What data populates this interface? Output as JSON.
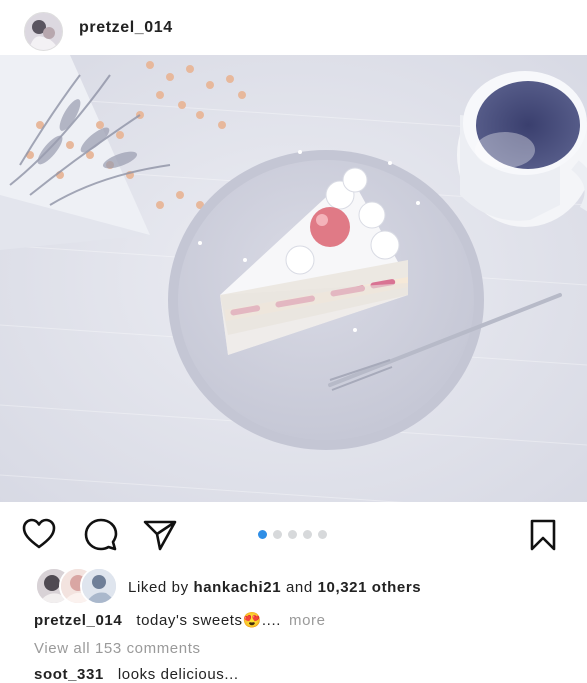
{
  "post": {
    "username": "pretzel_014",
    "photo_alt": "",
    "carousel": {
      "count": 5,
      "active_index": 0
    },
    "likes": {
      "prefix": "Liked by",
      "user": "hankachi21",
      "joiner": "and",
      "others": "10,321 others"
    },
    "caption": {
      "username": "pretzel_014",
      "text": "today's sweets😍....",
      "more": "more"
    },
    "view_all_comments": "View all 153 comments",
    "comments": [
      {
        "username": "soot_331",
        "text": "looks delicious..."
      }
    ]
  },
  "icons": {
    "like": "heart-icon",
    "comment": "comment-icon",
    "share": "send-icon",
    "save": "bookmark-icon"
  },
  "colors": {
    "accent": "#2f8ee6",
    "muted": "#9a9a9a",
    "text": "#222222"
  }
}
